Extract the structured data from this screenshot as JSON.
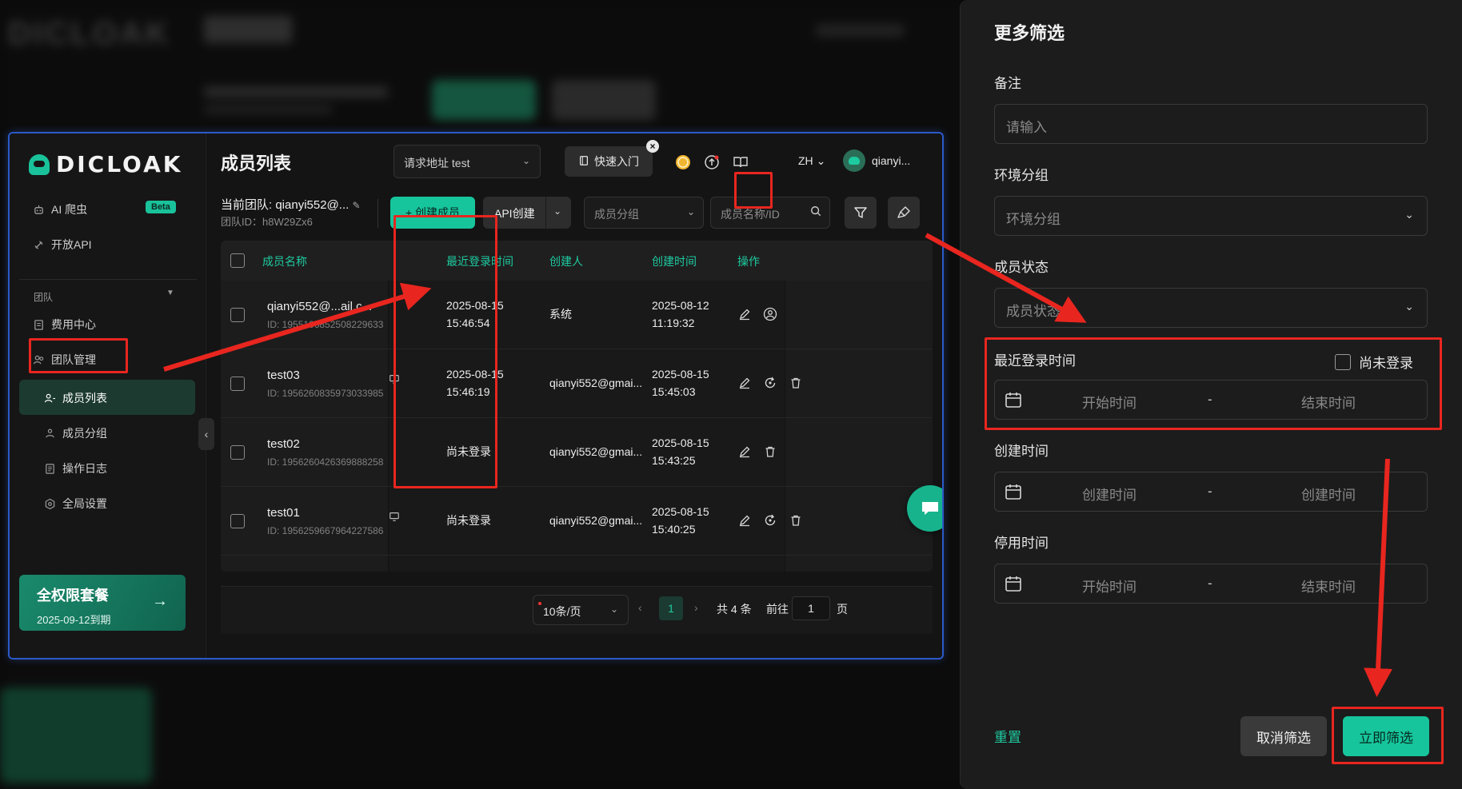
{
  "sidebar": {
    "logo_text": "DICLOAK",
    "items": [
      {
        "label": "AI 爬虫",
        "badge": "Beta"
      },
      {
        "label": "开放API"
      }
    ],
    "section": "团队",
    "fee": "费用中心",
    "team_mgmt": "团队管理",
    "sub_items": [
      "成员列表",
      "成员分组",
      "操作日志",
      "全局设置"
    ],
    "plan": {
      "title": "全权限套餐",
      "expiry": "2025-09-12到期"
    }
  },
  "header": {
    "title": "成员列表",
    "request_address": "请求地址  test",
    "quick_start": "快速入门",
    "lang": "ZH",
    "user": "qianyi..."
  },
  "toolbar": {
    "team_label": "当前团队: qianyi552@...",
    "team_id": "团队ID：h8W29Zx6",
    "create_member": "+ 创建成员",
    "api_create": "API创建",
    "group_placeholder": "成员分组",
    "search_placeholder": "成员名称/ID"
  },
  "table": {
    "columns": [
      "成员名称",
      "最近登录时间",
      "创建人",
      "创建时间",
      "操作"
    ],
    "rows": [
      {
        "name": "qianyi552@...ail.c...",
        "id": "ID: 1955106852508229633",
        "last_login_1": "2025-08-15",
        "last_login_2": "15:46:54",
        "creator": "系统",
        "created_1": "2025-08-12",
        "created_2": "11:19:32"
      },
      {
        "name": "test03",
        "id": "ID: 1956260835973033985",
        "last_login_1": "2025-08-15",
        "last_login_2": "15:46:19",
        "creator": "qianyi552@gmai...",
        "created_1": "2025-08-15",
        "created_2": "15:45:03"
      },
      {
        "name": "test02",
        "id": "ID: 1956260426369888258",
        "last_login_1": "尚未登录",
        "last_login_2": "",
        "creator": "qianyi552@gmai...",
        "created_1": "2025-08-15",
        "created_2": "15:43:25"
      },
      {
        "name": "test01",
        "id": "ID: 1956259667964227586",
        "last_login_1": "尚未登录",
        "last_login_2": "",
        "creator": "qianyi552@gmai...",
        "created_1": "2025-08-15",
        "created_2": "15:40:25"
      }
    ]
  },
  "pager": {
    "per_page": "10条/页",
    "current": "1",
    "total": "共 4 条",
    "goto_label": "前往",
    "goto_value": "1",
    "unit": "页"
  },
  "filter_panel": {
    "title": "更多筛选",
    "remark_label": "备注",
    "remark_placeholder": "请输入",
    "env_group_label": "环境分组",
    "env_group_placeholder": "环境分组",
    "status_label": "成员状态",
    "status_placeholder": "成员状态",
    "last_login_label": "最近登录时间",
    "not_logged_label": "尚未登录",
    "start_time": "开始时间",
    "end_time": "结束时间",
    "created_label": "创建时间",
    "created_start": "创建时间",
    "created_end": "创建时间",
    "disabled_label": "停用时间",
    "dash": "-",
    "reset": "重置",
    "cancel": "取消筛选",
    "apply": "立即筛选"
  },
  "colors": {
    "accent": "#17c59c",
    "highlight": "#e8261f",
    "window_border": "#2b59c8"
  }
}
